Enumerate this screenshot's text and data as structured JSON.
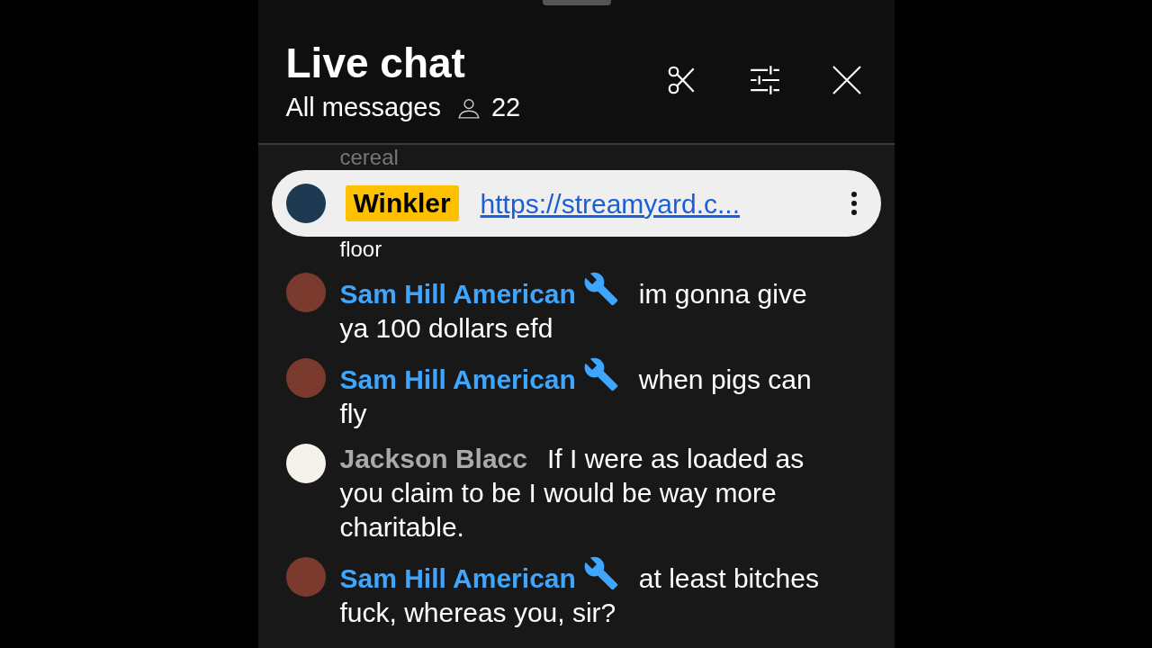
{
  "header": {
    "title": "Live chat",
    "filter": "All messages",
    "viewer_count": "22"
  },
  "pinned": {
    "author": "Winkler",
    "link": "https://streamyard.c..."
  },
  "fragments": {
    "above": "cereal",
    "below": "floor"
  },
  "messages": [
    {
      "author": "Sam Hill American",
      "kind": "moderator",
      "text": "im gonna give ya 100 dollars efd"
    },
    {
      "author": "Sam Hill American",
      "kind": "moderator",
      "text": "when pigs can fly"
    },
    {
      "author": "Jackson Blacc",
      "kind": "viewer",
      "text": "If I were as loaded as you claim to be I would be way more charitable."
    },
    {
      "author": "Sam Hill American",
      "kind": "moderator",
      "text": "at least bitches fuck, whereas you, sir?"
    }
  ]
}
